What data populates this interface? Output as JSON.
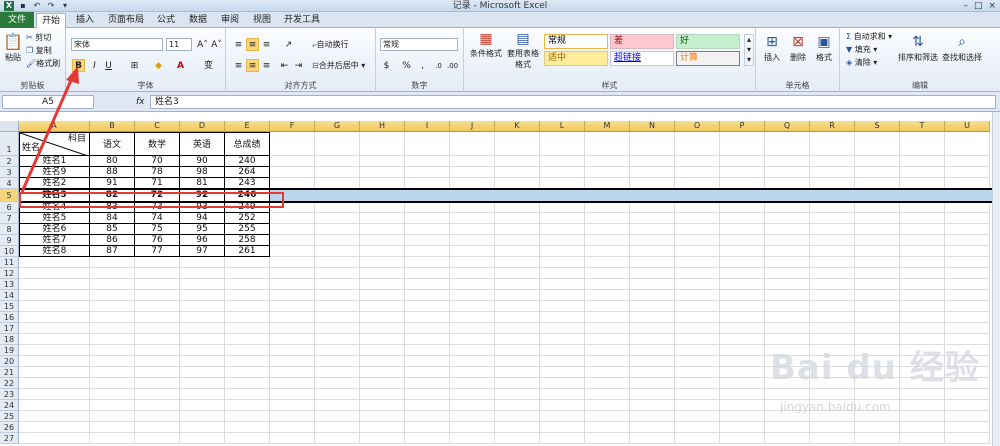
{
  "window": {
    "title": "记录 - Microsoft Excel",
    "minimize": "–",
    "maximize": "□",
    "close": "×"
  },
  "qat": {
    "undo": "↶",
    "redo": "↷",
    "more": "▾"
  },
  "tabs": [
    "文件",
    "开始",
    "插入",
    "页面布局",
    "公式",
    "数据",
    "审阅",
    "视图",
    "开发工具"
  ],
  "clipboard": {
    "paste": "粘贴",
    "cut": "剪切",
    "copy": "复制",
    "format_painter": "格式刷",
    "label": "剪贴板"
  },
  "font": {
    "name": "宋体",
    "size": "11",
    "grow": "A˄",
    "shrink": "A˅",
    "bold": "B",
    "italic": "I",
    "underline": "U",
    "label": "字体"
  },
  "alignment": {
    "wrap": "自动换行",
    "merge": "合并后居中",
    "label": "对齐方式"
  },
  "number": {
    "format": "常规",
    "label": "数字"
  },
  "styles": {
    "conditional": "条件格式",
    "table": "套用表格格式",
    "cells": [
      {
        "text": "常规",
        "bg": "#ffffff",
        "color": "#000000",
        "border": "#e3b847"
      },
      {
        "text": "差",
        "bg": "#ffc7ce",
        "color": "#9c0006",
        "border": "#d8b8bd"
      },
      {
        "text": "好",
        "bg": "#c6efce",
        "color": "#006100",
        "border": "#b5d6bb"
      },
      {
        "text": "适中",
        "bg": "#ffeb9c",
        "color": "#9c6500",
        "border": "#d8cb92"
      },
      {
        "text": "超链接",
        "bg": "#ffffff",
        "color": "#0000ff",
        "border": "#c5cbd3"
      },
      {
        "text": "计算",
        "bg": "#f2f2f2",
        "color": "#fa7d00",
        "border": "#7f7f7f"
      }
    ],
    "label": "样式"
  },
  "cells_grp": {
    "insert": "插入",
    "delete": "删除",
    "format": "格式",
    "label": "单元格"
  },
  "editing": {
    "autosum": "自动求和",
    "fill": "填充",
    "clear": "清除",
    "sort": "排序和筛选",
    "find": "查找和选择",
    "label": "编辑"
  },
  "formula_bar": {
    "name_box": "A5",
    "fx": "fx",
    "content": "姓名3"
  },
  "columns": [
    "A",
    "B",
    "C",
    "D",
    "E",
    "F",
    "G",
    "H",
    "I",
    "J",
    "K",
    "L",
    "M",
    "N",
    "O",
    "P",
    "Q",
    "R",
    "S",
    "T",
    "U"
  ],
  "rows": [
    "1",
    "2",
    "3",
    "4",
    "5",
    "6",
    "7",
    "8",
    "9",
    "10",
    "11",
    "12",
    "13",
    "14",
    "15",
    "16",
    "17",
    "18",
    "19",
    "20",
    "21",
    "22",
    "23",
    "24",
    "25",
    "26",
    "27"
  ],
  "header_cell": {
    "top": "科目",
    "bottom": "姓名"
  },
  "table_headers": [
    "语文",
    "数学",
    "英语",
    "总成绩"
  ],
  "table_rows": [
    [
      "姓名1",
      "80",
      "70",
      "90",
      "240"
    ],
    [
      "姓名9",
      "88",
      "78",
      "98",
      "264"
    ],
    [
      "姓名2",
      "91",
      "71",
      "81",
      "243"
    ],
    [
      "姓名3",
      "82",
      "72",
      "92",
      "246"
    ],
    [
      "姓名4",
      "83",
      "73",
      "93",
      "249"
    ],
    [
      "姓名5",
      "84",
      "74",
      "94",
      "252"
    ],
    [
      "姓名6",
      "85",
      "75",
      "95",
      "255"
    ],
    [
      "姓名7",
      "86",
      "76",
      "96",
      "258"
    ],
    [
      "姓名8",
      "87",
      "77",
      "97",
      "261"
    ]
  ],
  "selected_row_index": 3,
  "watermark": {
    "main": "Bai du 经验",
    "sub": "jingyan.baidu.com"
  }
}
